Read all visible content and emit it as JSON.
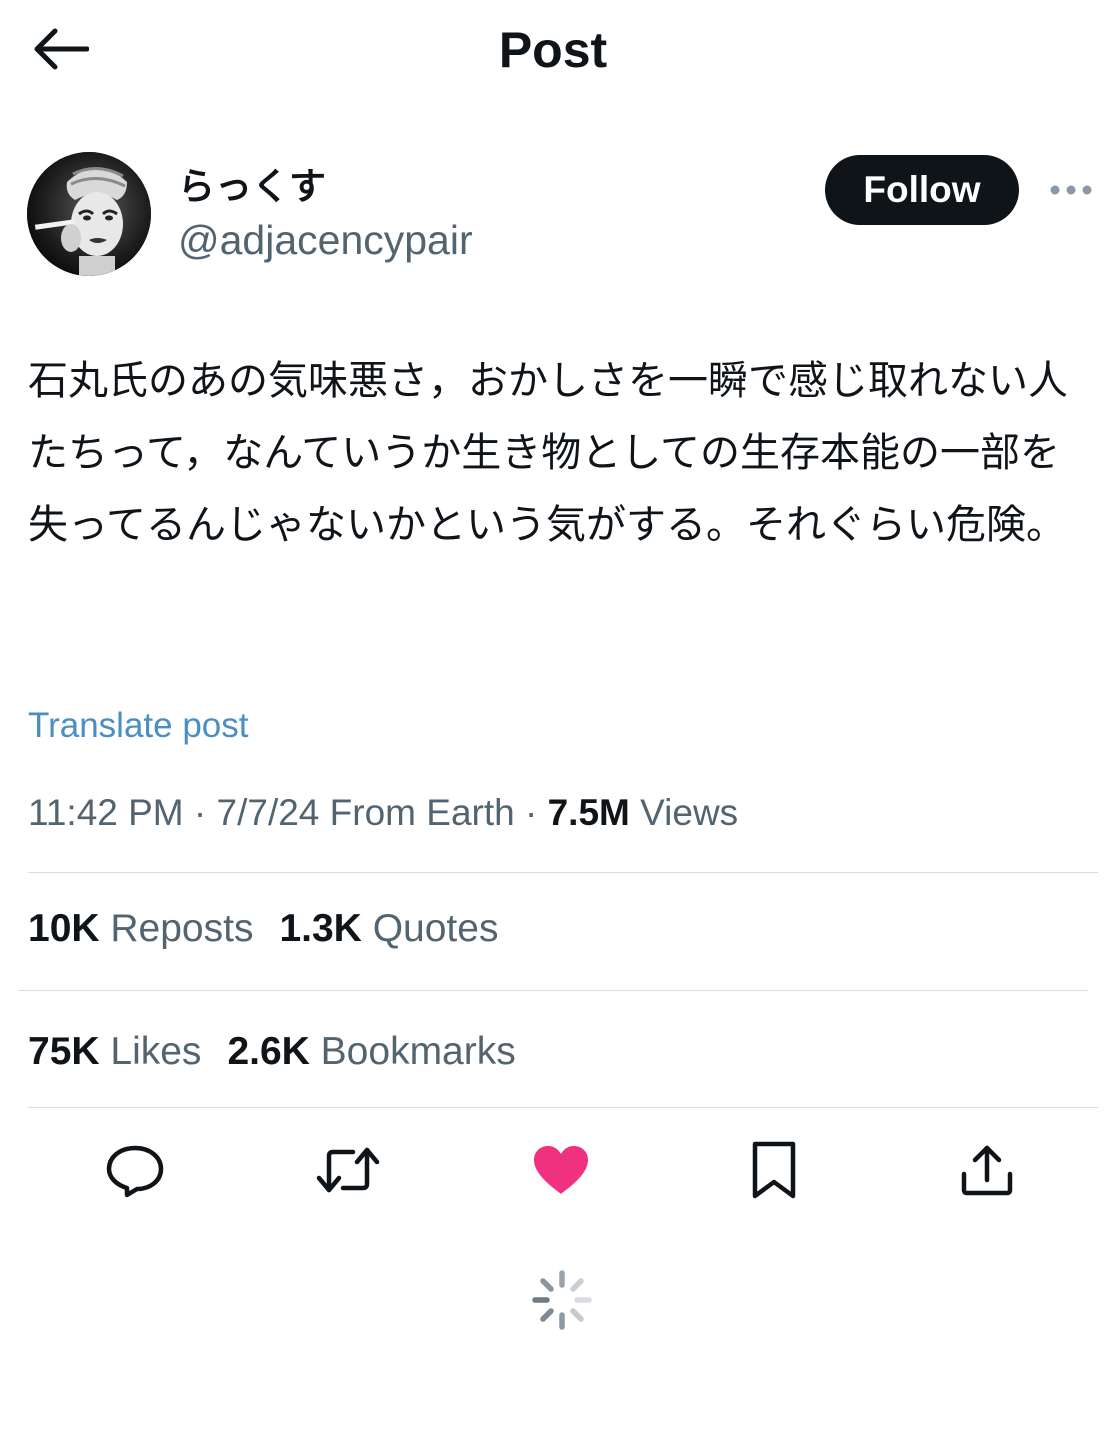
{
  "header": {
    "title": "Post",
    "back_icon": "arrow-left-icon"
  },
  "author": {
    "display_name": "らっくす",
    "handle": "@adjacencypair",
    "follow_label": "Follow",
    "more_icon": "more-horizontal-icon"
  },
  "post": {
    "text": "石丸氏のあの気味悪さ，おかしさを一瞬で感じ取れない人たちって，なんていうか生き物としての生存本能の一部を失ってるんじゃないかという気がする。それぐらい危険。",
    "translate_label": "Translate post",
    "time": "11:42 PM",
    "date": "7/7/24",
    "source": "From Earth",
    "views_count": "7.5M",
    "views_label": "Views"
  },
  "stats": {
    "reposts_count": "10K",
    "reposts_label": "Reposts",
    "quotes_count": "1.3K",
    "quotes_label": "Quotes",
    "likes_count": "75K",
    "likes_label": "Likes",
    "bookmarks_count": "2.6K",
    "bookmarks_label": "Bookmarks"
  },
  "actions": {
    "icons": [
      "reply-icon",
      "repost-icon",
      "like-icon",
      "bookmark-icon",
      "share-icon"
    ],
    "liked": true
  },
  "colors": {
    "text": "#0f1419",
    "secondary": "#536471",
    "link": "#4a8fc2",
    "like": "#f0317f",
    "divider": "#d9dde1",
    "follow_bg": "#0f1419"
  }
}
